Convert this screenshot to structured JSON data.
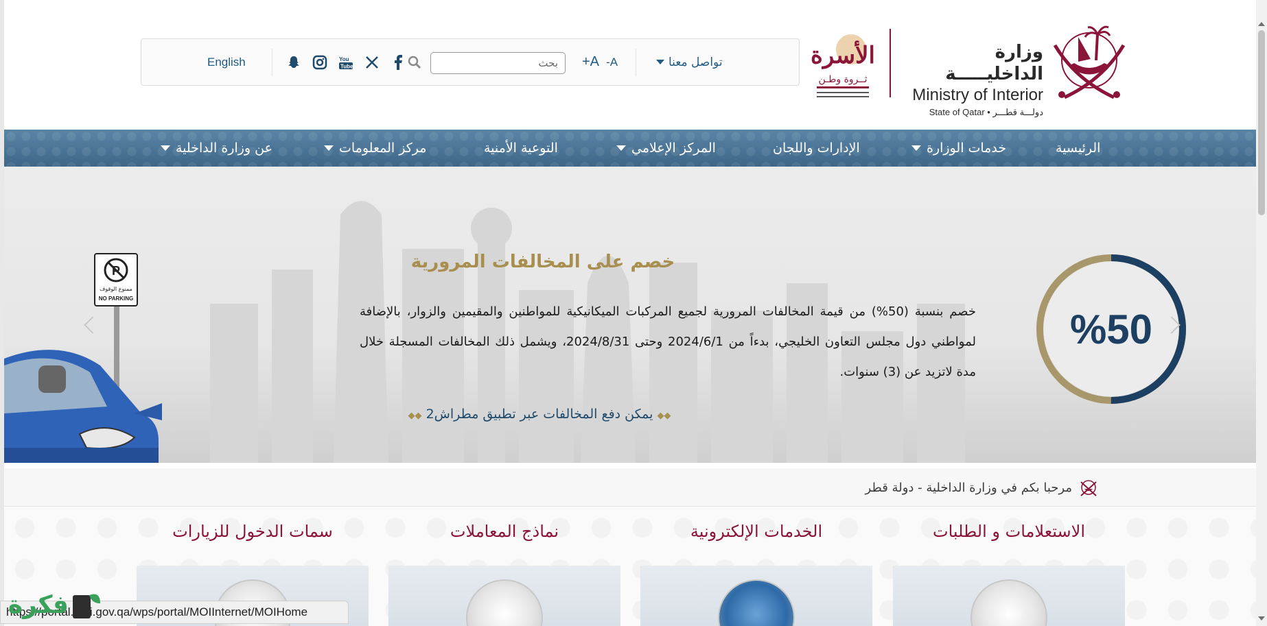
{
  "header": {
    "toolbar": {
      "language_label": "English",
      "search_placeholder": "بحث",
      "font_increase_label": "+A",
      "font_decrease_label": "-A",
      "contact_label": "تواصل معنا"
    },
    "social_icons": [
      "snapchat-icon",
      "instagram-icon",
      "youtube-icon",
      "x-icon",
      "facebook-icon"
    ],
    "moi_logo": {
      "arabic_name": "وزارة الداخليـــــة",
      "english_name": "Ministry of Interior",
      "subtitle": "State of Qatar • دولـــة قطـــر"
    },
    "family_logo": {
      "title": "الأسرة",
      "subtitle": "ثــروة وطـن"
    }
  },
  "nav": {
    "items": [
      {
        "label": "الرئيسية",
        "has_dropdown": false
      },
      {
        "label": "خدمات الوزارة",
        "has_dropdown": true
      },
      {
        "label": "الإدارات واللجان",
        "has_dropdown": false
      },
      {
        "label": "المركز الإعلامي",
        "has_dropdown": true
      },
      {
        "label": "التوعية الأمنية",
        "has_dropdown": false
      },
      {
        "label": "مركز المعلومات",
        "has_dropdown": true
      },
      {
        "label": "عن وزارة الداخلية",
        "has_dropdown": true
      }
    ]
  },
  "banner": {
    "title": "خصم على المخالفات المرورية",
    "body": "خصم بنسبة (50%) من قيمة المخالفات المرورية لجميع المركبات الميكانيكية للمواطنين والمقيمين والزوار، بالإضافة لمواطني دول مجلس التعاون الخليجي، بدءاً من 2024/6/1 وحتى 2024/8/31، ويشمل ذلك المخالفات المسجلة خلال مدة لاتزيد عن (3) سنوات.",
    "link_text": "يمكن دفع المخالفات عبر تطبيق مطراش2",
    "circle_text": "%50",
    "progress_fraction": 0.5,
    "sign_text_ar": "ممنوع الوقوف",
    "sign_text_en": "NO PARKING"
  },
  "welcome": {
    "text": "مرحبا بكم في وزارة الداخلية - دولة قطر"
  },
  "services": [
    {
      "title": "الاستعلامات و الطلبات"
    },
    {
      "title": "الخدمات الإلكترونية"
    },
    {
      "title": "نماذج المعاملات"
    },
    {
      "title": "سمات الدخول للزيارات"
    }
  ],
  "statusbar": {
    "url": "https://portal.moi.gov.qa/wps/portal/MOIInternet/MOIHome"
  },
  "watermark": {
    "text": "فكرة"
  },
  "colors": {
    "nav_background": "#4a7396",
    "brand_maroon": "#8a1538",
    "banner_gold": "#a88f50",
    "link_blue": "#1f5b85"
  }
}
